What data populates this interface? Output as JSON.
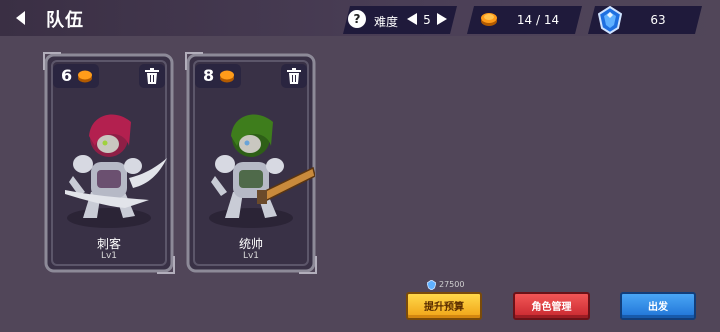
{
  "header": {
    "back_icon": "back-arrow-icon",
    "title": "队伍"
  },
  "difficulty": {
    "help_icon_glyph": "?",
    "label": "难度",
    "value": "5"
  },
  "cost": {
    "text": "14 / 14",
    "icon": "coin-icon"
  },
  "gems": {
    "count": "63",
    "icon": "gem-icon"
  },
  "cards": [
    {
      "cost": "6",
      "name": "刺客",
      "level": "Lv1",
      "hair_color": "#b3204f"
    },
    {
      "cost": "8",
      "name": "统帅",
      "level": "Lv1",
      "hair_color": "#3e7d1c"
    }
  ],
  "budget": {
    "cost": "27500"
  },
  "buttons": {
    "upgrade": "提升预算",
    "roles": "角色管理",
    "depart": "出发"
  }
}
